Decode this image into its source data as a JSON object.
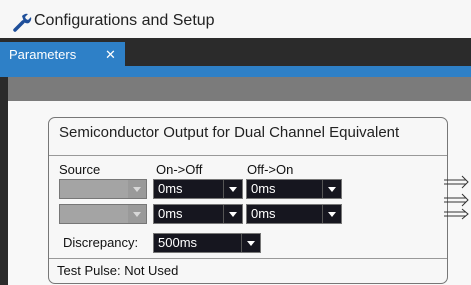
{
  "window": {
    "title": "Configurations and Setup",
    "icon": "wrench-icon"
  },
  "tabs": [
    {
      "label": "Parameters",
      "close": "✕",
      "active": true
    }
  ],
  "panel": {
    "title": "Semiconductor Output for Dual Channel Equivalent",
    "columns": {
      "source": "Source",
      "on_off": "On->Off",
      "off_on": "Off->On"
    },
    "rows": [
      {
        "source": "",
        "on_off": "0ms",
        "off_on": "0ms"
      },
      {
        "source": "",
        "on_off": "0ms",
        "off_on": "0ms"
      }
    ],
    "discrepancy": {
      "label": "Discrepancy:",
      "value": "500ms"
    },
    "test_pulse": "Test Pulse: Not Used"
  },
  "colors": {
    "accent": "#2e80c7",
    "combo_active": "#16161f",
    "combo_disabled": "#a4a4a4"
  }
}
